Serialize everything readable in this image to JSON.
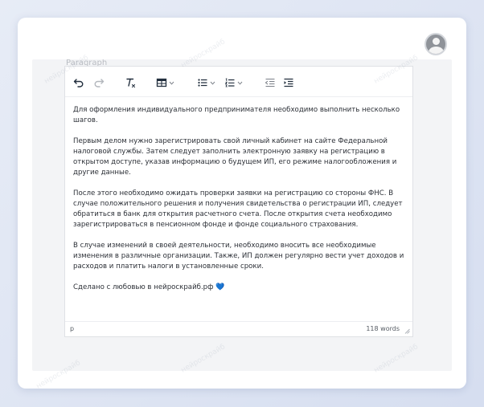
{
  "avatar": {
    "icon": "user-avatar-icon"
  },
  "toolbar": {
    "faded_label": "Paragraph",
    "buttons": [
      {
        "name": "undo-icon"
      },
      {
        "name": "redo-icon"
      },
      {
        "name": "clear-formatting-icon"
      },
      {
        "name": "table-icon"
      },
      {
        "name": "bullet-list-icon"
      },
      {
        "name": "numbered-list-icon"
      },
      {
        "name": "outdent-icon"
      },
      {
        "name": "indent-icon"
      }
    ]
  },
  "content": {
    "paragraphs": [
      "Для оформления индивидуального предпринимателя необходимо выполнить несколько шагов.",
      "Первым делом нужно зарегистрировать свой личный кабинет на сайте Федеральной налоговой службы. Затем следует заполнить электронную заявку на регистрацию в открытом доступе, указав информацию о будущем ИП, его режиме налогообложения и другие данные.",
      "После этого необходимо ожидать проверки заявки на регистрацию со стороны ФНС. В случае положительного решения и получения свидетельства о регистрации ИП, следует обратиться в банк для открытия расчетного счета. После открытия счета необходимо зарегистрироваться в пенсионном фонде и фонде социального страхования.",
      "В случае изменений в своей деятельности, необходимо вносить все необходимые изменения в различные организации. Также, ИП должен регулярно вести учет доходов и расходов и платить налоги в установленные сроки."
    ],
    "signature": "Сделано с любовью в нейроскрайб.рф",
    "heart": "💙"
  },
  "statusbar": {
    "path": "p",
    "word_count": "118 words"
  },
  "watermark": "нейроскрайб"
}
